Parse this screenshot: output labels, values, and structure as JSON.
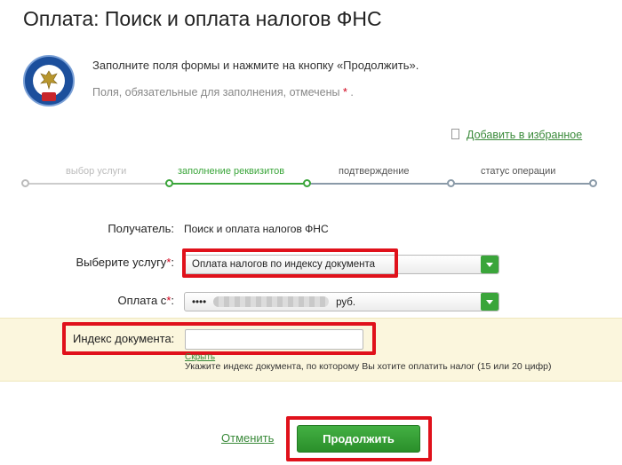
{
  "page": {
    "title": "Оплата: Поиск и оплата налогов ФНС",
    "intro": "Заполните поля формы и нажмите на кнопку «Продолжить».",
    "required_note": "Поля, обязательные для заполнения, отмечены",
    "required_mark": "*",
    "required_note_end": "."
  },
  "favorites": {
    "label": "Добавить в избранное"
  },
  "steps": [
    {
      "label": "выбор услуги",
      "state": "done"
    },
    {
      "label": "заполнение реквизитов",
      "state": "active"
    },
    {
      "label": "подтверждение",
      "state": "upcoming"
    },
    {
      "label": "статус операции",
      "state": "upcoming"
    }
  ],
  "form": {
    "recipient_label": "Получатель:",
    "recipient_value": "Поиск и оплата налогов ФНС",
    "service_label": "Выберите услугу",
    "service_value": "Оплата налогов по индексу документа",
    "payfrom_label": "Оплата с",
    "payfrom_prefix": "••••",
    "payfrom_suffix": "руб.",
    "index_label": "Индекс документа:",
    "index_value": "",
    "hide_link": "Скрыть",
    "index_hint": "Укажите индекс документа, по которому Вы хотите оплатить налог (15 или 20 цифр)",
    "colon": ":"
  },
  "actions": {
    "cancel_label": "Отменить",
    "continue_label": "Продолжить"
  },
  "colors": {
    "accent_green": "#3aa53a",
    "highlight_red": "#e0111b",
    "band_yellow": "#fbf6dd"
  },
  "icons": {
    "logo": "fns-emblem-icon",
    "favorite": "bookmark-icon",
    "dropdown": "chevron-down-icon"
  }
}
